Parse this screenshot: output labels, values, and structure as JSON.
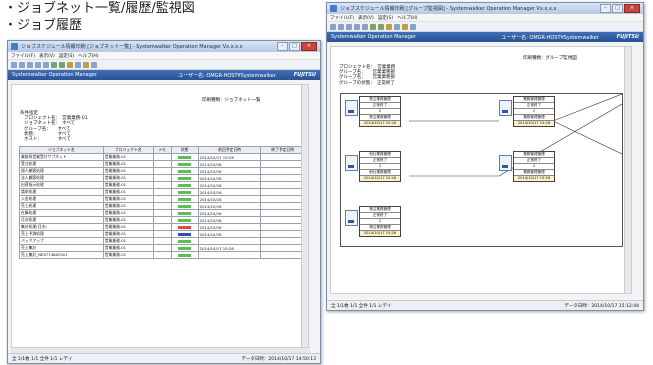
{
  "captions": {
    "line1": "・ジョブネット一覧/履歴/監視図",
    "line2": "・ジョブ履歴"
  },
  "colors": {
    "accent_blue": "#2a5295",
    "close_red": "#c9443a",
    "status_green": "#5bbf55",
    "status_red": "#d84a3a",
    "status_blue": "#2f4fb8"
  },
  "left": {
    "title": "ジョブスケジュール情報印刷 [ジョブネット一覧] - Systemwalker Operation Manager  Vx.x.x.x",
    "menu": [
      "ファイル(F)",
      "表示(V)",
      "設定(S)",
      "ヘルプ(H)"
    ],
    "product": "Systemwalker Operation Manager",
    "server": "ユーザー名: OMGR-HOST¥Systemwalker",
    "brand": "FUJITSU",
    "report_kind": "印刷種類：ジョブネット一覧",
    "conditions_header": "条件指定",
    "conditions": [
      "プロジェクト名：　営業業務-01",
      "ジョブネット名：　すべて",
      "グループ名：　　すべて",
      "状態：　　　　　すべて",
      "ホスト：　　　　すべて"
    ],
    "table": {
      "headers": [
        "ジョブネット名",
        "プロジェクト名",
        "メモ",
        "状態",
        "前回予定日時",
        "終了予定日時"
      ],
      "rows": [
        [
          "業務系営業受付サブネット",
          "営業業務-01",
          "",
          "green",
          "2014/10/17 15:26",
          ""
        ],
        [
          "受注処理",
          "営業業務-01",
          "",
          "green",
          "2014/10/16",
          ""
        ],
        [
          "個人顧客処理",
          "営業業務-01",
          "",
          "green",
          "2014/10/16",
          ""
        ],
        [
          "法人顧客処理",
          "営業業務-01",
          "",
          "green",
          "2014/10/16",
          ""
        ],
        [
          "出荷指示処理",
          "営業業務-01",
          "",
          "green",
          "2014/10/16",
          ""
        ],
        [
          "請求処理",
          "営業業務-01",
          "",
          "green",
          "2014/10/16",
          ""
        ],
        [
          "入金処理",
          "営業業務-01",
          "",
          "green",
          "2014/10/16",
          ""
        ],
        [
          "売上処理",
          "営業業務-01",
          "",
          "green",
          "2014/10/16",
          ""
        ],
        [
          "在庫処理",
          "営業業務-01",
          "",
          "green",
          "2014/10/16",
          ""
        ],
        [
          "月次処理",
          "営業業務-01",
          "",
          "green",
          "2014/10/16",
          ""
        ],
        [
          "集計処理(日次)",
          "営業業務-01",
          "",
          "red",
          "2014/10/16",
          ""
        ],
        [
          "売上予測処理",
          "営業業務-01",
          "",
          "blue",
          "2014/10/16",
          ""
        ],
        [
          "バックアップ",
          "営業業務-01",
          "",
          "green",
          "",
          ""
        ],
        [
          "売上集計",
          "営業業務-01",
          "",
          "green",
          "2014/10/17 15:26",
          ""
        ],
        [
          "売上集計_NEXT74BAT001",
          "営業業務-01",
          "",
          "green",
          "",
          ""
        ]
      ]
    },
    "status": {
      "pages": "全 1/1枚  1/1  全件  1/1  レデイ",
      "datetime": "データ日時：2014/10/17 14:50:13"
    }
  },
  "right": {
    "title": "ジョブスケジュール情報印刷 [グループ監視図] - Systemwalker Operation Manager  Vx.x.x.x",
    "menu": [
      "ファイル(F)",
      "表示(V)",
      "設定(S)",
      "ヘルプ(H)"
    ],
    "product": "Systemwalker Operation Manager",
    "server": "ユーザー名: OMGR-HOST¥Systemwalker",
    "brand": "FUJITSU",
    "report_kind": "印刷種類：グループ監視図",
    "conditions": [
      "プロジェクト名：　営業業務",
      "グループ名：　　営業業務部",
      "グループ名：　　営業業務部",
      "グループの状態：　正常終了"
    ],
    "nodes": [
      {
        "l1": "受注業務管理",
        "l2": "正常終了",
        "l3": "2",
        "l4": "受注業務管理",
        "l5": "2014/10/17 15:26"
      },
      {
        "l1": "業務管理管理",
        "l2": "正常終了",
        "l3": "2",
        "l4": "業務管理管理",
        "l5": "2014/10/17 15:26"
      },
      {
        "l1": "他社業務管理",
        "l2": "正常終了",
        "l3": "2",
        "l4": "他社業務管理",
        "l5": "2014/10/17 15:26"
      },
      {
        "l1": "業務管理管理",
        "l2": "正常終了",
        "l3": "2",
        "l4": "業務管理管理",
        "l5": "2014/10/17 15:26"
      },
      {
        "l1": "発注業務管理",
        "l2": "正常終了",
        "l3": "2",
        "l4": "発注業務管理",
        "l5": "2014/10/17 15:26"
      }
    ],
    "status": {
      "pages": "全 1/1枚  1/1  全件  1/1  レデイ",
      "datetime": "データ日時：2014/10/17 15:12:44"
    }
  }
}
